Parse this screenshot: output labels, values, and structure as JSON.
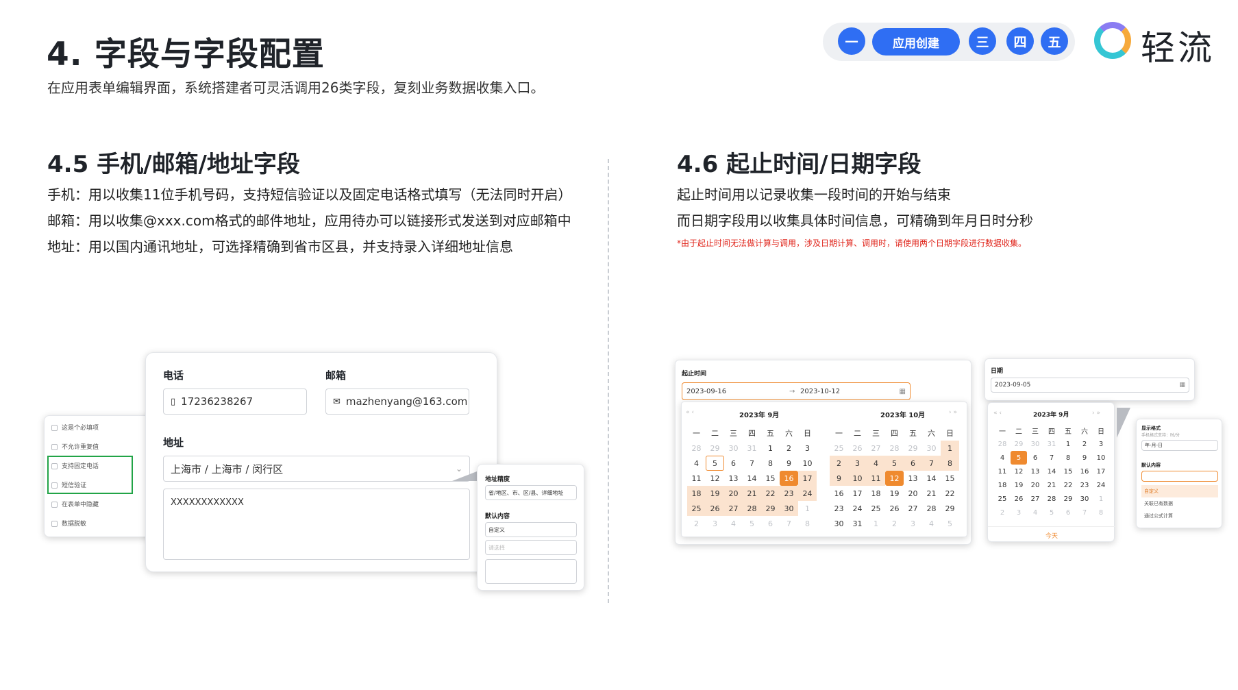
{
  "header": {
    "title": "4. 字段与字段配置",
    "subtitle": "在应用表单编辑界面，系统搭建者可灵活调用26类字段，复刻业务数据收集入口。"
  },
  "nav": {
    "steps": [
      "一",
      "应用创建",
      "三",
      "四",
      "五"
    ],
    "accent": "#2f6ef3"
  },
  "logo": {
    "text": "轻流"
  },
  "left": {
    "title": "4.5 手机/邮箱/地址字段",
    "lines": [
      "手机：用以收集11位手机号码，支持短信验证以及固定电话格式填写（无法同时开启）",
      "邮箱：用以收集@xxx.com格式的邮件地址，应用待办可以链接形式发送到对应邮箱中",
      "地址：用以国内通讯地址，可选择精确到省市区县，并支持录入详细地址信息"
    ],
    "form": {
      "phone_label": "电话",
      "phone_value": "17236238267",
      "email_label": "邮箱",
      "email_value": "mazhenyang@163.com",
      "address_label": "地址",
      "address_value": "上海市 / 上海市 / 闵行区",
      "detail_value": "XXXXXXXXXXXX"
    },
    "options": [
      "这是个必填项",
      "不允许重复值",
      "支持固定电话",
      "短信验证",
      "在表单中隐藏",
      "数据脱敏"
    ],
    "addr_panel": {
      "precision_label": "地址精度",
      "precision_value": "省/地区、市、区/县、详细地址",
      "default_label": "默认内容",
      "default_value": "自定义",
      "placeholder": "请选择"
    }
  },
  "right": {
    "title": "4.6 起止时间/日期字段",
    "lines": [
      "起止时间用以记录收集一段时间的开始与结束",
      "而日期字段用以收集具体时间信息，可精确到年月日时分秒"
    ],
    "note": "*由于起止时间无法做计算与调用，涉及日期计算、调用时，请使用两个日期字段进行数据收集。",
    "range": {
      "label": "起止时间",
      "start": "2023-09-16",
      "end": "2023-10-12",
      "arrow": "→",
      "month1": "2023年  9月",
      "month2": "2023年  10月",
      "weekdays": [
        "一",
        "二",
        "三",
        "四",
        "五",
        "六",
        "日"
      ],
      "cal1": [
        [
          "28",
          "29",
          "30",
          "31",
          "1",
          "2",
          "3"
        ],
        [
          "4",
          "5",
          "6",
          "7",
          "8",
          "9",
          "10"
        ],
        [
          "11",
          "12",
          "13",
          "14",
          "15",
          "16",
          "17"
        ],
        [
          "18",
          "19",
          "20",
          "21",
          "22",
          "23",
          "24"
        ],
        [
          "25",
          "26",
          "27",
          "28",
          "29",
          "30",
          "1"
        ],
        [
          "2",
          "3",
          "4",
          "5",
          "6",
          "7",
          "8"
        ]
      ],
      "cal2": [
        [
          "25",
          "26",
          "27",
          "28",
          "29",
          "30",
          "1"
        ],
        [
          "2",
          "3",
          "4",
          "5",
          "6",
          "7",
          "8"
        ],
        [
          "9",
          "10",
          "11",
          "12",
          "13",
          "14",
          "15"
        ],
        [
          "16",
          "17",
          "18",
          "19",
          "20",
          "21",
          "22"
        ],
        [
          "23",
          "24",
          "25",
          "26",
          "27",
          "28",
          "29"
        ],
        [
          "30",
          "31",
          "1",
          "2",
          "3",
          "4",
          "5"
        ]
      ]
    },
    "date": {
      "label": "日期",
      "value": "2023-09-05",
      "month": "2023年  9月",
      "today": "今天",
      "cal": [
        [
          "28",
          "29",
          "30",
          "31",
          "1",
          "2",
          "3"
        ],
        [
          "4",
          "5",
          "6",
          "7",
          "8",
          "9",
          "10"
        ],
        [
          "11",
          "12",
          "13",
          "14",
          "15",
          "16",
          "17"
        ],
        [
          "18",
          "19",
          "20",
          "21",
          "22",
          "23",
          "24"
        ],
        [
          "25",
          "26",
          "27",
          "28",
          "29",
          "30",
          "1"
        ],
        [
          "2",
          "3",
          "4",
          "5",
          "6",
          "7",
          "8"
        ]
      ]
    },
    "fmt_panel": {
      "title": "显示格式",
      "hint": "手机格式支持：时/分",
      "value": "年-月-日",
      "default_label": "默认内容",
      "opt1": "自定义",
      "opt2": "关联已有数据",
      "opt3": "通过公式计算"
    }
  }
}
